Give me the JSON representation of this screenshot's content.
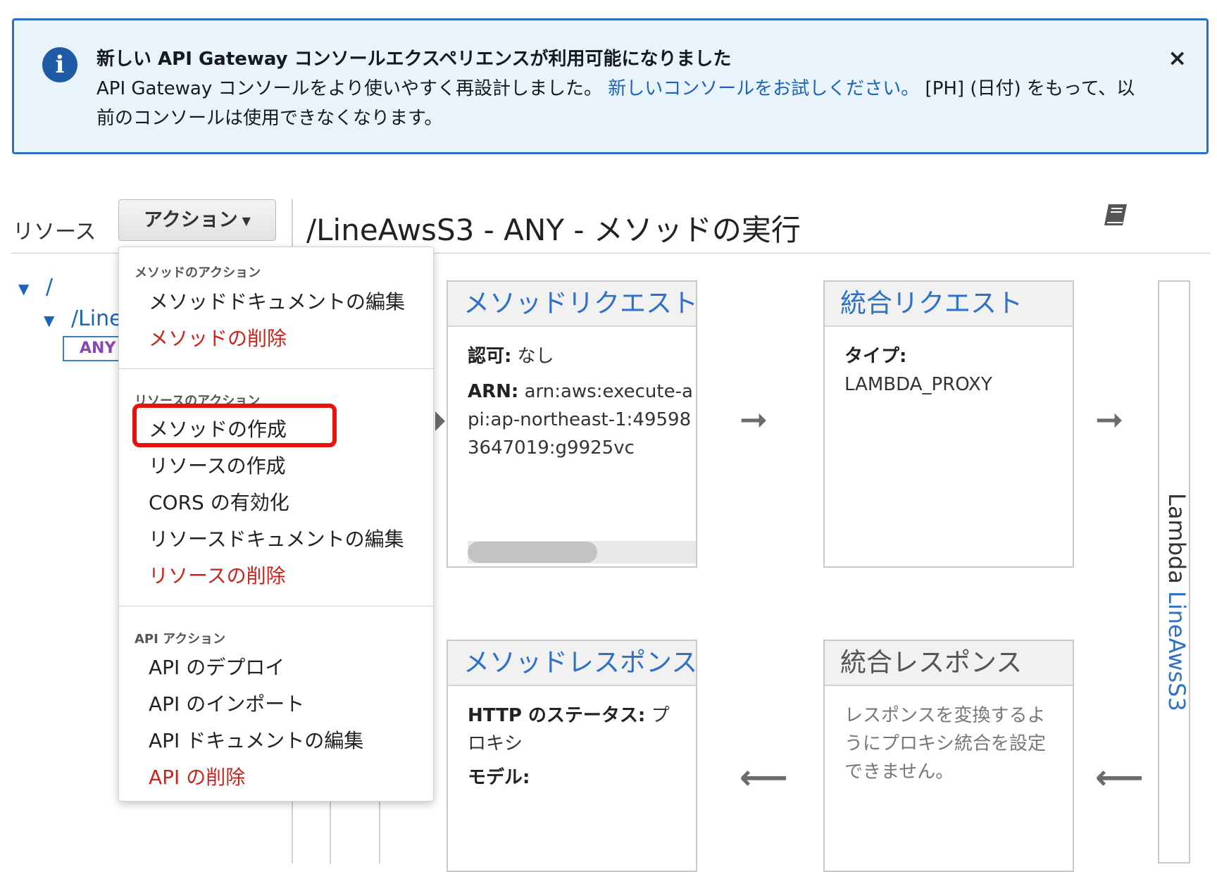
{
  "banner": {
    "title": "新しい API Gateway コンソールエクスペリエンスが利用可能になりました",
    "body_pre": "API Gateway コンソールをより使いやすく再設計しました。 ",
    "body_link": "新しいコンソールをお試しください。",
    "body_post": " [PH] (日付) をもって、以前のコンソールは使用できなくなります。",
    "close": "×"
  },
  "header": {
    "resources_label": "リソース",
    "actions_button": "アクション",
    "actions_caret": "▼",
    "title": "/LineAwsS3 - ANY - メソッドの実行",
    "book_icon": "book-icon"
  },
  "tree": {
    "root": "/",
    "child": "/LineAwsS3",
    "method": "ANY"
  },
  "dropdown": {
    "method_actions_title": "メソッドのアクション",
    "method_items": [
      "メソッドドキュメントの編集",
      "メソッドの削除"
    ],
    "resource_actions_title": "リソースのアクション",
    "resource_items": [
      "メソッドの作成",
      "リソースの作成",
      "CORS の有効化",
      "リソースドキュメントの編集",
      "リソースの削除"
    ],
    "api_actions_title": "API アクション",
    "api_items": [
      "API のデプロイ",
      "API のインポート",
      "API ドキュメントの編集",
      "API の削除"
    ]
  },
  "method_request": {
    "title": "メソッドリクエスト",
    "auth_label": "認可:",
    "auth_value": "なし",
    "arn_label": "ARN:",
    "arn_value": "arn:aws:execute-api:ap-northeast-1:495983647019:g9925vc"
  },
  "integration_request": {
    "title": "統合リクエスト",
    "type_label": "タイプ:",
    "type_value": "LAMBDA_PROXY"
  },
  "method_response": {
    "title": "メソッドレスポンス",
    "status_label": "HTTP のステータス:",
    "status_value": "プロキシ",
    "model_label": "モデル:"
  },
  "integration_response": {
    "title": "統合レスポンス",
    "note": "レスポンスを変換するようにプロキシ統合を設定できません。"
  },
  "lambda": {
    "prefix": "Lambda ",
    "function": "LineAwsS3"
  },
  "arrows": {
    "right": "➞",
    "left": "⟵"
  },
  "colors": {
    "banner_bg": "#e9f3fc",
    "banner_border": "#2c71c1",
    "link": "#2f71c6",
    "danger": "#c9231d",
    "highlight": "#e8120c",
    "method_badge": "#8a46b6"
  }
}
